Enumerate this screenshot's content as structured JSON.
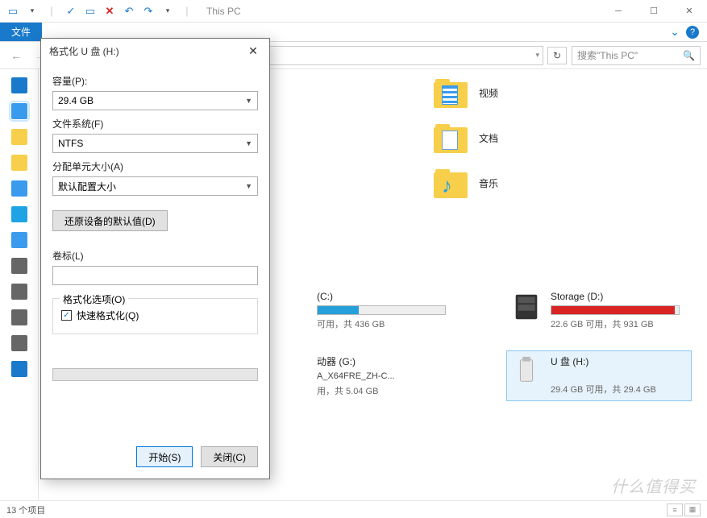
{
  "window": {
    "title": "This PC",
    "file_tab": "文件"
  },
  "toolbar": {
    "search_placeholder": "搜索\"This PC\""
  },
  "folders": [
    {
      "label": "视频",
      "kind": "video"
    },
    {
      "label": "文档",
      "kind": "doc"
    },
    {
      "label": "音乐",
      "kind": "music"
    }
  ],
  "drives": {
    "c": {
      "name": "(C:)",
      "stats": "可用，共 436 GB",
      "pct": 32
    },
    "d": {
      "name": "Storage (D:)",
      "stats": "22.6 GB 可用，共 931 GB",
      "pct": 97
    },
    "g": {
      "name": "动器 (G:)",
      "line2": "A_X64FRE_ZH-C...",
      "stats": "用，共 5.04 GB"
    },
    "h": {
      "name": "U 盘 (H:)",
      "stats": "29.4 GB 可用，共 29.4 GB"
    }
  },
  "statusbar": {
    "items": "13 个项目"
  },
  "dialog": {
    "title": "格式化 U 盘 (H:)",
    "capacity_label": "容量(P):",
    "capacity_value": "29.4 GB",
    "fs_label": "文件系统(F)",
    "fs_value": "NTFS",
    "au_label": "分配单元大小(A)",
    "au_value": "默认配置大小",
    "restore_btn": "还原设备的默认值(D)",
    "volume_label": "卷标(L)",
    "volume_value": "",
    "options_legend": "格式化选项(O)",
    "quick_format": "快速格式化(Q)",
    "start_btn": "开始(S)",
    "close_btn": "关闭(C)"
  },
  "watermark": "什么值得买"
}
